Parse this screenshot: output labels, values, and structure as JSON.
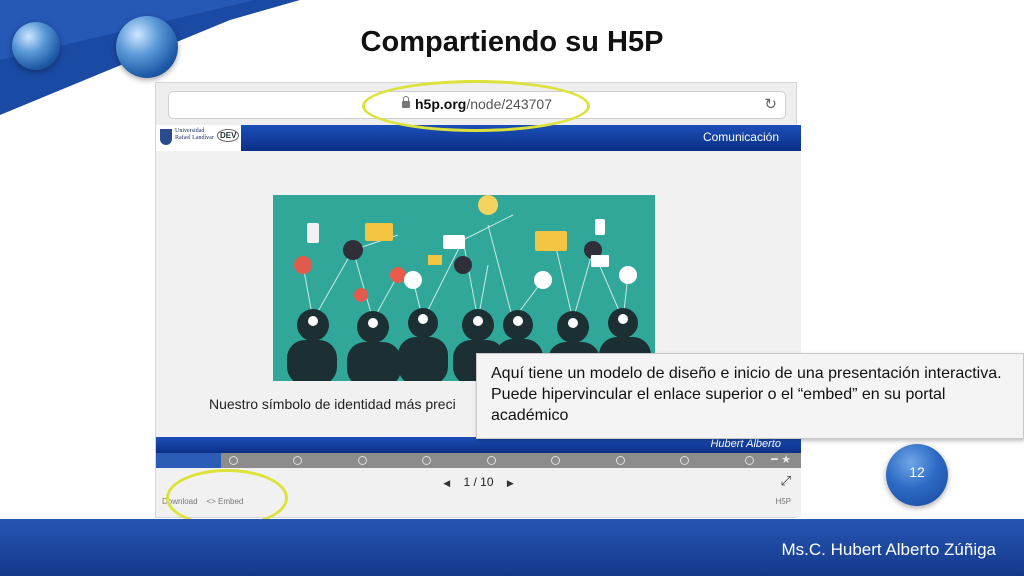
{
  "slide": {
    "title": "Compartiendo su H5P",
    "page_number": "12",
    "author": "Ms.C. Hubert Alberto Zúñiga"
  },
  "browser": {
    "url_host": "h5p.org",
    "url_path": "/node/243707",
    "lock_icon": "lock-icon",
    "reload_icon": "reload-icon"
  },
  "h5p": {
    "header_title": "Comunicación",
    "logo_text": "Universidad\nRafael Landívar",
    "dev_logo_text": "DEV",
    "caption": "Nuestro símbolo de identidad más preci",
    "author_bar": "Hubert Alberto",
    "pager": {
      "current": "1",
      "separator": "/",
      "total": "10"
    },
    "progress": {
      "current": 1,
      "total": 10
    },
    "footer": {
      "download": "Download",
      "embed": "<> Embed",
      "h5p_mark": "H5P"
    }
  },
  "callout": {
    "text": "Aquí tiene un modelo de diseño e inicio de una presentación interactiva. Puede hipervincular el enlace superior o el “embed” en su portal académico"
  },
  "colors": {
    "accent_blue": "#1d4fb8",
    "highlight_yellow": "#dde23a",
    "image_teal": "#31a79a"
  }
}
